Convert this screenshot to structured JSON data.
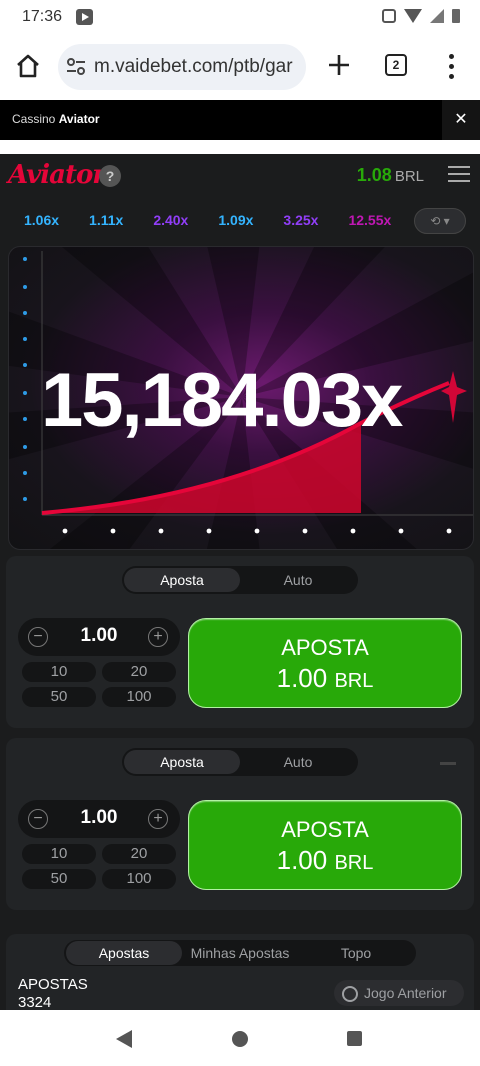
{
  "status_bar": {
    "time": "17:36"
  },
  "browser": {
    "url": "m.vaidebet.com/ptb/gar",
    "tab_count": "2"
  },
  "casino_bar": {
    "prefix": "Cassino",
    "game": "Aviator",
    "close_label": "✕"
  },
  "game_header": {
    "logo": "Aviator",
    "help_label": "?",
    "balance": "1.08",
    "currency": "BRL"
  },
  "history": [
    {
      "value": "1.06x",
      "color": "#34b4ff"
    },
    {
      "value": "1.11x",
      "color": "#34b4ff"
    },
    {
      "value": "2.40x",
      "color": "#913ef8"
    },
    {
      "value": "1.09x",
      "color": "#34b4ff"
    },
    {
      "value": "3.25x",
      "color": "#913ef8"
    },
    {
      "value": "12.55x",
      "color": "#c017b4"
    }
  ],
  "history_button": {
    "label": "⟲ ▾"
  },
  "game": {
    "multiplier": "15,184.03x"
  },
  "bet_panels": [
    {
      "tabs": [
        "Aposta",
        "Auto"
      ],
      "active_tab": "Aposta",
      "amount": "1.00",
      "quick_amounts": [
        "10",
        "20",
        "50",
        "100"
      ],
      "button_line1": "APOSTA",
      "button_amount": "1.00",
      "button_currency": "BRL"
    },
    {
      "tabs": [
        "Aposta",
        "Auto"
      ],
      "active_tab": "Aposta",
      "amount": "1.00",
      "quick_amounts": [
        "10",
        "20",
        "50",
        "100"
      ],
      "button_line1": "APOSTA",
      "button_amount": "1.00",
      "button_currency": "BRL"
    }
  ],
  "bets_list": {
    "tabs": [
      "Apostas",
      "Minhas Apostas",
      "Topo"
    ],
    "active_tab": "Apostas",
    "label": "APOSTAS",
    "count": "3324",
    "previous_game_label": "Jogo Anterior"
  },
  "colors": {
    "accent_green": "#28a909",
    "brand_red": "#e50539"
  }
}
